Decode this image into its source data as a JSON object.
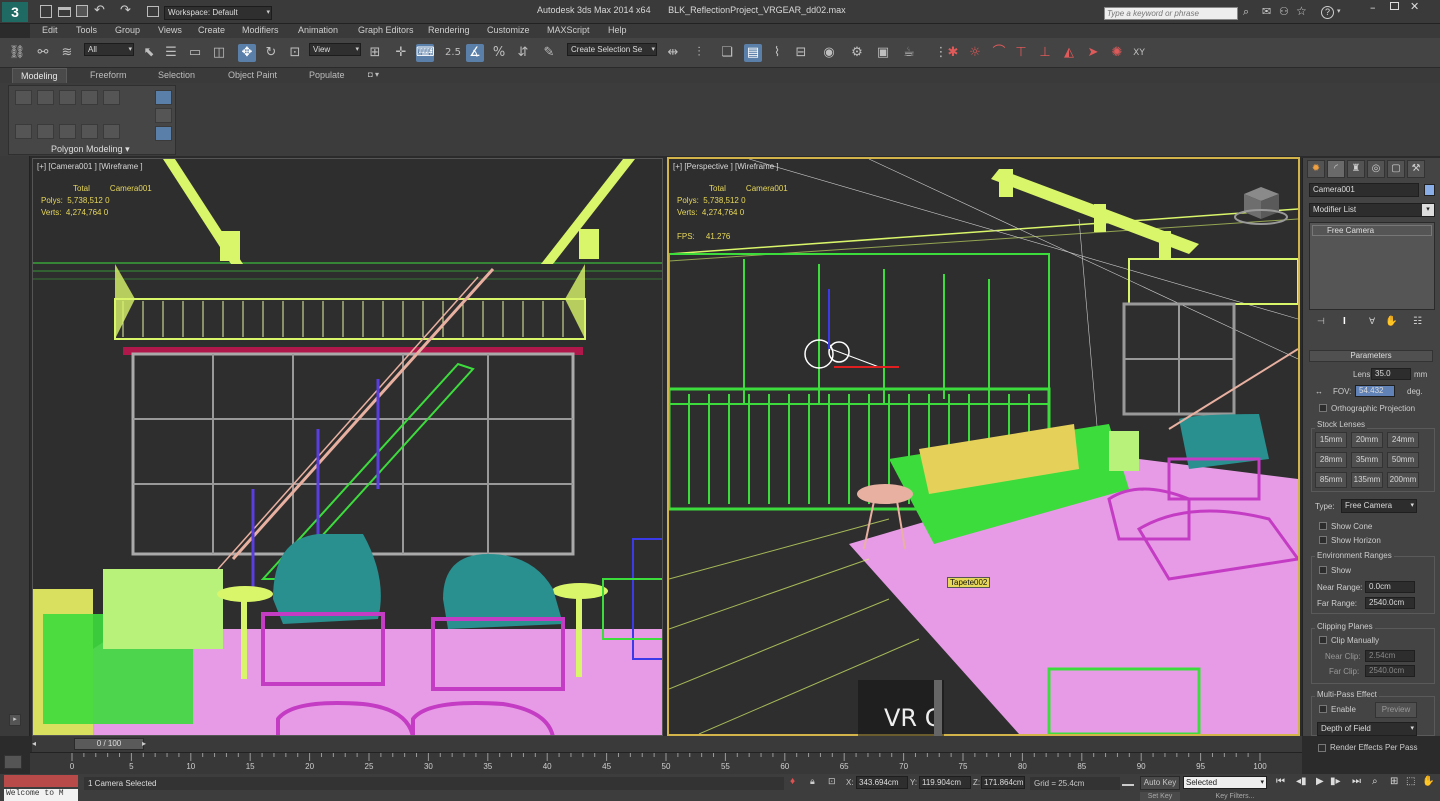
{
  "title": {
    "center": "Autodesk 3ds Max 2014 x64",
    "file": "BLK_ReflectionProject_VRGEAR_dd02.max",
    "workspace": "Workspace: Default",
    "search_placeholder": "Type a keyword or phrase",
    "help_icon": "?"
  },
  "menu": [
    "Edit",
    "Tools",
    "Group",
    "Views",
    "Create",
    "Modifiers",
    "Animation",
    "Graph Editors",
    "Rendering",
    "Customize",
    "MAXScript",
    "Help"
  ],
  "toolbar": {
    "filter": "All",
    "refcoord": "View",
    "snap_value": "2.5",
    "selection_set": "Create Selection Se"
  },
  "ribbon": {
    "tabs": [
      "Modeling",
      "Freeform",
      "Selection",
      "Object Paint",
      "Populate"
    ],
    "panel": "Polygon Modeling"
  },
  "viewports": {
    "left": {
      "label": "[+] [Camera001 ] [Wireframe ]",
      "stats_header": "Total",
      "stats_obj": "Camera001",
      "polys_label": "Polys:",
      "polys": "5,738,512",
      "polys_obj": "0",
      "verts_label": "Verts:",
      "verts": "4,274,764",
      "verts_obj": "0"
    },
    "right": {
      "label": "[+] [Perspective ] [Wireframe ]",
      "stats_header": "Total",
      "stats_obj": "Camera001",
      "polys_label": "Polys:",
      "polys": "5,738,512",
      "polys_obj": "0",
      "verts_label": "Verts:",
      "verts": "4,274,764",
      "verts_obj": "0",
      "fps_label": "FPS:",
      "fps": "41.276",
      "tooltip": "Tapete002",
      "overlay_text": "VR C"
    }
  },
  "command_panel": {
    "object_name": "Camera001",
    "modifier_list": "Modifier List",
    "stack_item": "Free Camera",
    "params_title": "Parameters",
    "lens_label": "Lens:",
    "lens": "35.0",
    "lens_unit": "mm",
    "fov_label": "FOV:",
    "fov": "54.432",
    "fov_unit": "deg.",
    "ortho": "Orthographic Projection",
    "stock_lenses": "Stock Lenses",
    "lenses": [
      "15mm",
      "20mm",
      "24mm",
      "28mm",
      "35mm",
      "50mm",
      "85mm",
      "135mm",
      "200mm"
    ],
    "type_label": "Type:",
    "type": "Free Camera",
    "show_cone": "Show Cone",
    "show_horizon": "Show Horizon",
    "env_ranges": "Environment Ranges",
    "env_show": "Show",
    "near_range_label": "Near Range:",
    "near_range": "0.0cm",
    "far_range_label": "Far Range:",
    "far_range": "2540.0cm",
    "clipping": "Clipping Planes",
    "clip_manually": "Clip Manually",
    "near_clip_label": "Near Clip:",
    "near_clip": "2.54cm",
    "far_clip_label": "Far Clip:",
    "far_clip": "2540.0cm",
    "multipass": "Multi-Pass Effect",
    "enable": "Enable",
    "preview": "Preview",
    "effect": "Depth of Field",
    "render_per_pass": "Render Effects Per Pass"
  },
  "timeline": {
    "frame": "0 / 100",
    "ticks": [
      "0",
      "5",
      "10",
      "15",
      "20",
      "25",
      "30",
      "35",
      "40",
      "45",
      "50",
      "55",
      "60",
      "65",
      "70",
      "75",
      "80",
      "85",
      "90",
      "95",
      "100"
    ]
  },
  "status": {
    "selection": "1 Camera Selected",
    "x_label": "X:",
    "x": "343.694cm",
    "y_label": "Y:",
    "y": "119.904cm",
    "z_label": "Z:",
    "z": "171.864cm",
    "grid": "Grid = 25.4cm",
    "autokey": "Auto Key",
    "key_mode": "Selected",
    "setkey": "Set Key",
    "keyfilters": "Key Filters...",
    "listener": "Welcome to M"
  },
  "colors": {
    "accent": "#5a7fa8",
    "active_border": "#d3b44a",
    "stats": "#e8d85a",
    "wire_green": "#3ddc3d",
    "wire_yellow": "#d9f56a",
    "wire_magenta": "#c43cc4",
    "wire_pink": "#e79be7",
    "wire_teal": "#2a8f8f"
  }
}
